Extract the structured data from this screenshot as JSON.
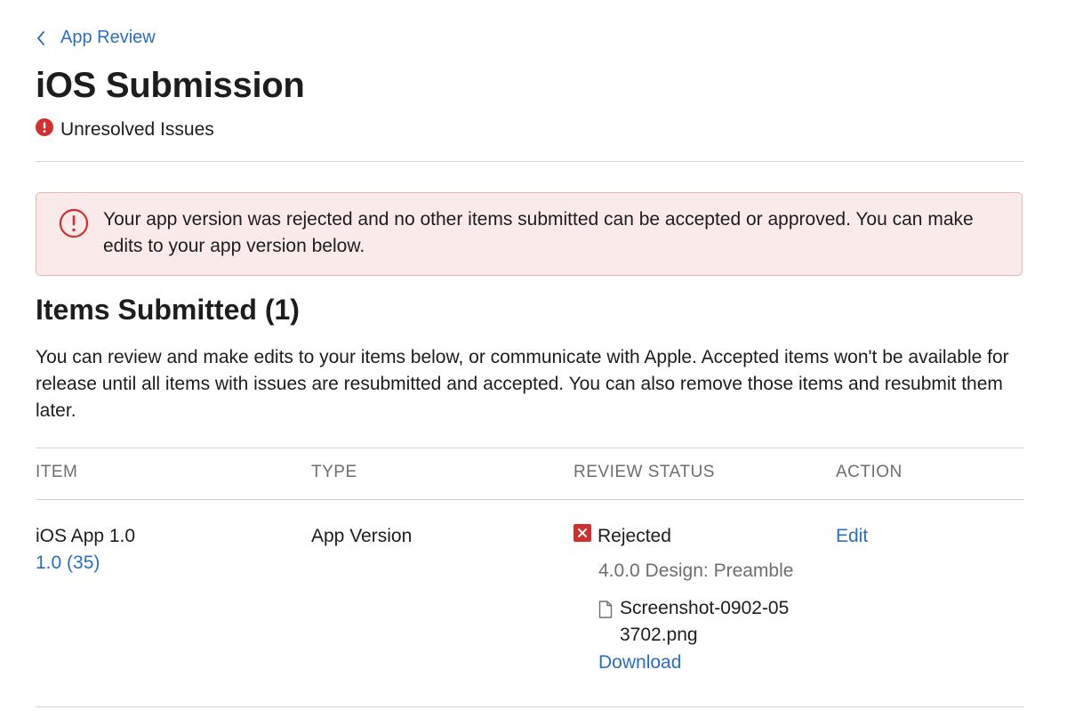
{
  "breadcrumb": {
    "label": "App Review"
  },
  "page": {
    "title": "iOS Submission",
    "status": "Unresolved Issues"
  },
  "alert": {
    "message": "Your app version was rejected and no other items submitted can be accepted or approved. You can make edits to your app version below."
  },
  "items_section": {
    "title": "Items Submitted (1)",
    "description": "You can review and make edits to your items below, or communicate with Apple. Accepted items won't be available for release until all items with issues are resubmitted and accepted. You can also remove those items and resubmit them later."
  },
  "table": {
    "headers": [
      "ITEM",
      "TYPE",
      "REVIEW STATUS",
      "ACTION"
    ],
    "rows": [
      {
        "item_name": "iOS App 1.0",
        "build": "1.0 (35)",
        "type": "App Version",
        "status": "Rejected",
        "guideline": "4.0.0 Design: Preamble",
        "attachment": "Screenshot-0902-053702.png",
        "download_label": "Download",
        "action": "Edit"
      }
    ]
  },
  "colors": {
    "link": "#2a6fc1",
    "error": "#d32f2f",
    "alert_bg": "#fbeaea",
    "alert_border": "#efb4b4",
    "divider": "#d2d2d7"
  },
  "icons": {
    "back": "chevron-left-icon",
    "status": "exclamation-circle-filled-icon",
    "alert": "exclamation-circle-outline-icon",
    "rejected": "x-square-icon",
    "attachment": "document-icon"
  }
}
